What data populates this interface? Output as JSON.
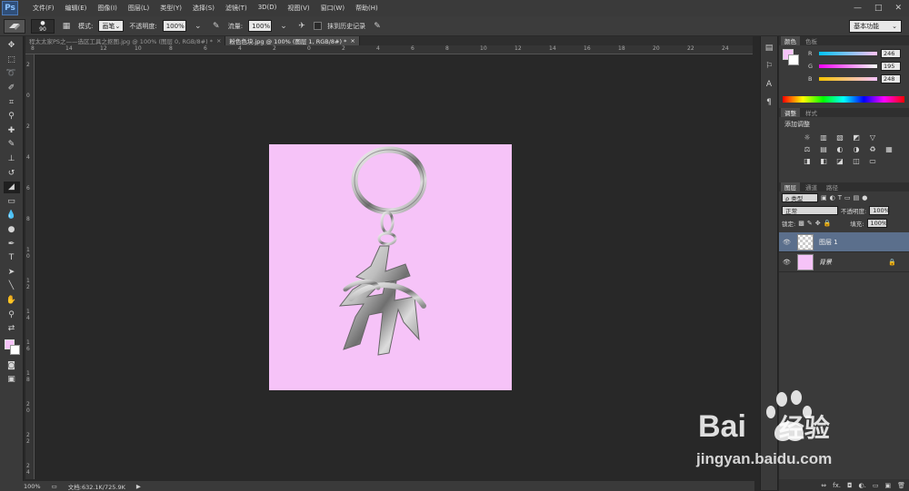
{
  "app": {
    "logo": "Ps"
  },
  "menu": [
    "文件(F)",
    "编辑(E)",
    "图像(I)",
    "图层(L)",
    "类型(Y)",
    "选择(S)",
    "滤镜(T)",
    "3D(D)",
    "视图(V)",
    "窗口(W)",
    "帮助(H)"
  ],
  "window_controls": {
    "minimize": "—",
    "maximize": "□",
    "close": "✕"
  },
  "options": {
    "brush_size": "90",
    "mode_label": "模式:",
    "mode_value": "画笔",
    "opacity_label": "不透明度:",
    "opacity_value": "100%",
    "flow_label": "流量:",
    "flow_value": "100%",
    "erase_history_label": "抹到历史记录",
    "workspace": "基本功能"
  },
  "tabs": [
    {
      "label": "程太太家PS之——选区工具之抠图.jpg @ 100% (图层 0, RGB/8#) *",
      "close": "×"
    },
    {
      "label": "粉色色块.jpg @ 100% (图层 1, RGB/8#) *",
      "close": "×"
    }
  ],
  "ruler": {
    "top": [
      "8",
      "14",
      "12",
      "10",
      "8",
      "6",
      "4",
      "2",
      "0",
      "2",
      "4",
      "6",
      "8",
      "10",
      "12",
      "14",
      "16",
      "18",
      "20",
      "22",
      "24"
    ],
    "left": [
      "2",
      "0",
      "2",
      "4",
      "6",
      "8",
      "1 0",
      "1 2",
      "1 4",
      "1 6",
      "1 8",
      "2 0",
      "2 2",
      "2 4"
    ]
  },
  "status": {
    "zoom": "100%",
    "doc_label": "文档:632.1K/725.9K",
    "arrow": "▶"
  },
  "color_panel": {
    "tabs": [
      "颜色",
      "色板"
    ],
    "r_label": "R",
    "r_value": "246",
    "g_label": "G",
    "g_value": "195",
    "b_label": "B",
    "b_value": "248",
    "foreground": "#f6c3f8"
  },
  "adjust_panel": {
    "tabs": [
      "调整",
      "样式"
    ],
    "title": "添加调整",
    "row1": [
      "☼",
      "▥",
      "▧",
      "◩",
      "▽"
    ],
    "row2": [
      "⚖",
      "▤",
      "◐",
      "◑",
      "♻",
      "▦"
    ],
    "row3": [
      "◨",
      "◧",
      "◪",
      "◫",
      "▭"
    ]
  },
  "layers_panel": {
    "tabs": [
      "图层",
      "通道",
      "路径"
    ],
    "filter_label": "ρ 类型",
    "blend_mode": "正常",
    "opacity_label": "不透明度:",
    "opacity_value": "100%",
    "lock_label": "锁定:",
    "fill_label": "填充:",
    "fill_value": "100%",
    "layers": [
      {
        "name": "图层 1",
        "selected": true
      },
      {
        "name": "背景",
        "selected": false,
        "locked": true
      }
    ],
    "footer": [
      "⇔",
      "fx.",
      "◘",
      "◐.",
      "▭",
      "▣",
      "🗑"
    ]
  },
  "document": {
    "background": "#f6c3f8"
  },
  "watermark": {
    "brand_left": "Bai",
    "brand_right": "经验",
    "url": "jingyan.baidu.com"
  }
}
